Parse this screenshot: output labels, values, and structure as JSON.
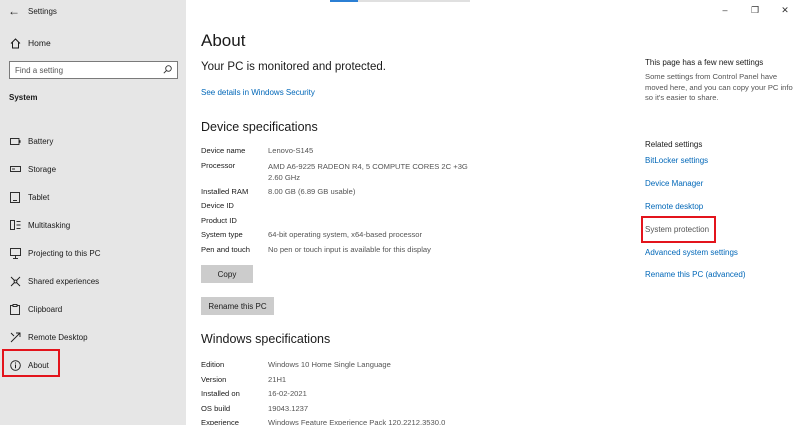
{
  "window": {
    "title": "Settings",
    "controls": {
      "minimize": "–",
      "maximize": "❐",
      "close": "✕"
    }
  },
  "sidebar": {
    "home_label": "Home",
    "search_placeholder": "Find a setting",
    "section_label": "System",
    "items": [
      {
        "label": "Battery",
        "icon": "battery-icon"
      },
      {
        "label": "Storage",
        "icon": "storage-icon"
      },
      {
        "label": "Tablet",
        "icon": "tablet-icon"
      },
      {
        "label": "Multitasking",
        "icon": "multitasking-icon"
      },
      {
        "label": "Projecting to this PC",
        "icon": "projecting-icon"
      },
      {
        "label": "Shared experiences",
        "icon": "shared-experiences-icon"
      },
      {
        "label": "Clipboard",
        "icon": "clipboard-icon"
      },
      {
        "label": "Remote Desktop",
        "icon": "remote-desktop-icon"
      },
      {
        "label": "About",
        "icon": "info-icon",
        "selected": true
      }
    ]
  },
  "main": {
    "title": "About",
    "status": "Your PC is monitored and protected.",
    "security_link": "See details in Windows Security",
    "device_heading": "Device specifications",
    "device_specs": [
      {
        "key": "Device name",
        "value": "Lenovo-S145"
      },
      {
        "key": "Processor",
        "value": "AMD A6-9225 RADEON R4, 5 COMPUTE CORES 2C +3G     2.60 GHz"
      },
      {
        "key": "Installed RAM",
        "value": "8.00 GB (6.89 GB usable)"
      },
      {
        "key": "Device ID",
        "value": ""
      },
      {
        "key": "Product ID",
        "value": ""
      },
      {
        "key": "System type",
        "value": "64-bit operating system, x64-based processor"
      },
      {
        "key": "Pen and touch",
        "value": "No pen or touch input is available for this display"
      }
    ],
    "copy_button": "Copy",
    "rename_button": "Rename this PC",
    "windows_heading": "Windows specifications",
    "windows_specs": [
      {
        "key": "Edition",
        "value": "Windows 10 Home Single Language"
      },
      {
        "key": "Version",
        "value": "21H1"
      },
      {
        "key": "Installed on",
        "value": "16-02-2021"
      },
      {
        "key": "OS build",
        "value": "19043.1237"
      },
      {
        "key": "Experience",
        "value": "Windows Feature Experience Pack 120.2212.3530.0"
      }
    ]
  },
  "right_panel": {
    "heading": "This page has a few new settings",
    "description": "Some settings from Control Panel have moved here, and you can copy your PC info so it's easier to share.",
    "related_heading": "Related settings",
    "links": [
      "BitLocker settings",
      "Device Manager",
      "Remote desktop",
      "System protection",
      "Advanced system settings",
      "Rename this PC (advanced)"
    ]
  },
  "colors": {
    "accent": "#0067b8",
    "sidebar_bg": "#e6e6e6",
    "highlight_box": "#e3141c",
    "button_bg": "#cccccc"
  }
}
